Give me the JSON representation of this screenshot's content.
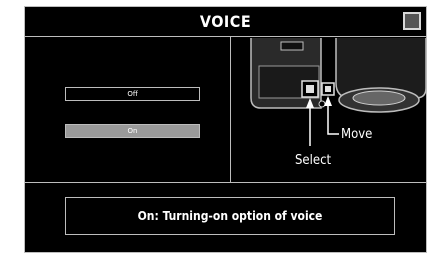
{
  "header": {
    "title": "VOICE",
    "close_icon": "square-icon"
  },
  "options": [
    {
      "label": "Off",
      "selected": false
    },
    {
      "label": "On",
      "selected": true
    }
  ],
  "illustration": {
    "select_label": "Select",
    "move_label": "Move"
  },
  "info": {
    "term": "On:",
    "description": "Turning-on option of voice"
  },
  "colors": {
    "background": "#000000",
    "border": "#bdbdbd",
    "selected": "#9a9a9a",
    "text": "#ffffff"
  }
}
